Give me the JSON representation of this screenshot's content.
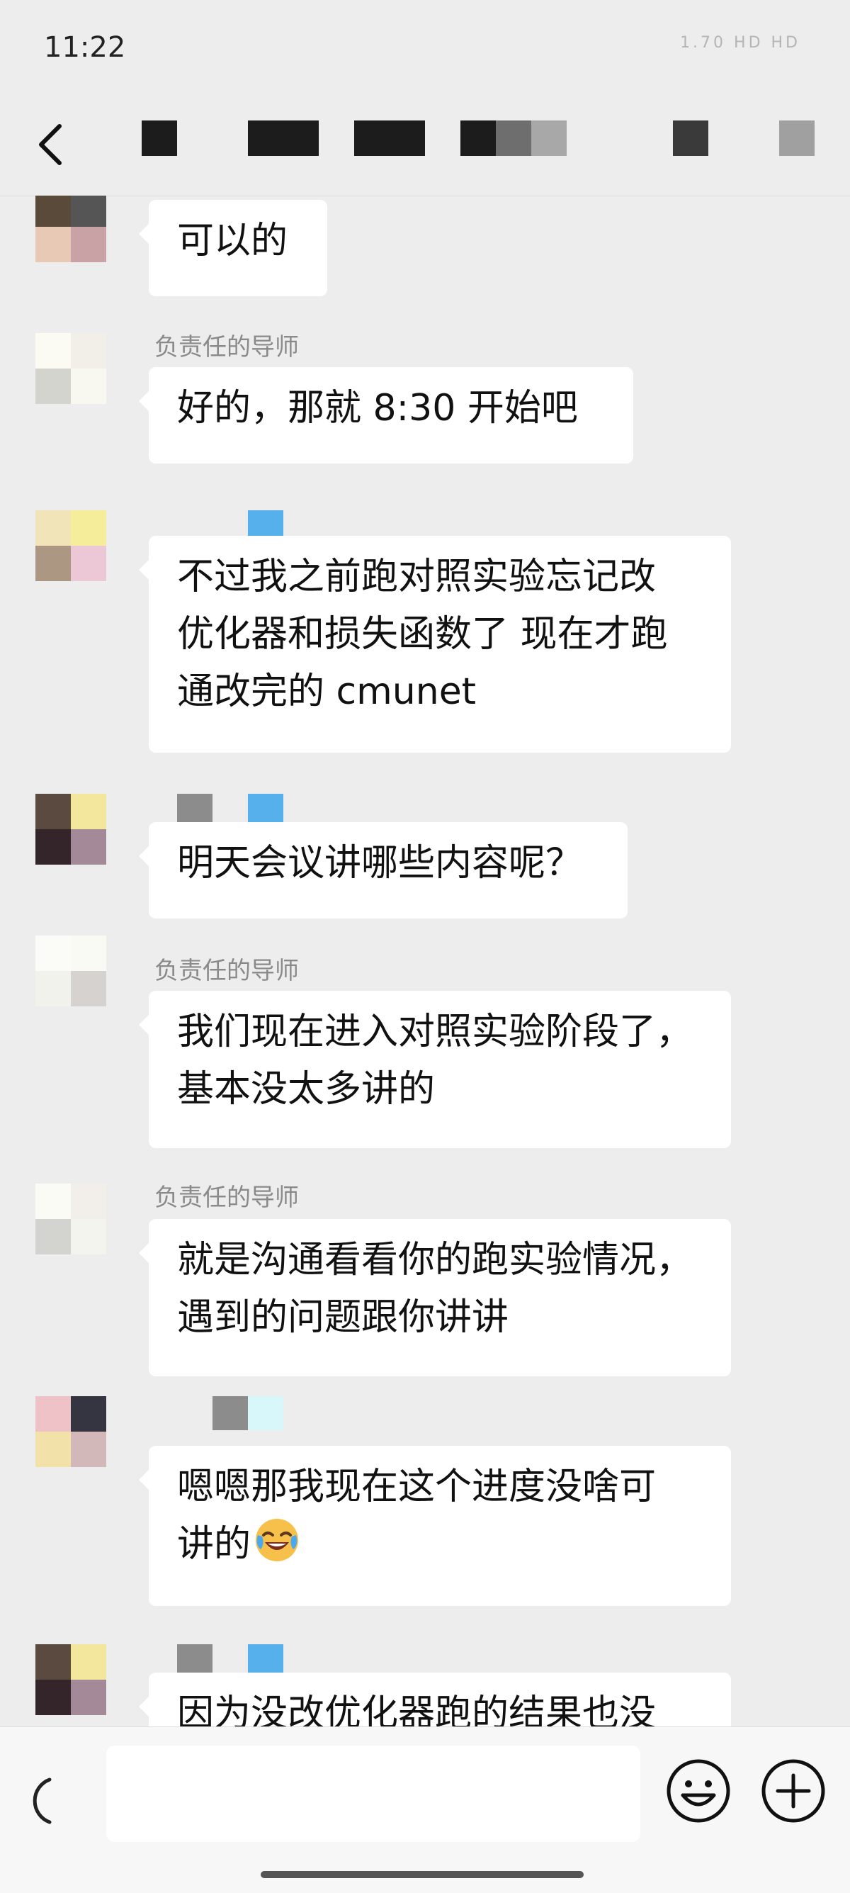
{
  "status_bar": {
    "time": "11:22",
    "indicators": "1.70 HD HD"
  },
  "header": {
    "back_icon": "chevron-left-icon"
  },
  "messages": [
    {
      "sender": "",
      "lines": [
        "可以的"
      ]
    },
    {
      "sender": "负责任的导师",
      "lines": [
        "好的，那就 8:30 开始吧"
      ]
    },
    {
      "sender": "",
      "lines": [
        "不过我之前跑对照实验忘记改",
        "优化器和损失函数了 现在才跑",
        "通改完的 cmunet"
      ]
    },
    {
      "sender": "",
      "lines": [
        "明天会议讲哪些内容呢？"
      ]
    },
    {
      "sender": "负责任的导师",
      "lines": [
        "我们现在进入对照实验阶段了，",
        "基本没太多讲的"
      ]
    },
    {
      "sender": "负责任的导师",
      "lines": [
        "就是沟通看看你的跑实验情况，",
        "遇到的问题跟你讲讲"
      ]
    },
    {
      "sender": "",
      "lines": [
        "嗯嗯那我现在这个进度没啥可",
        "讲的"
      ],
      "emoji": "face-with-tears-of-joy"
    },
    {
      "sender": "",
      "lines": [
        "因为没改优化器跑的结果也没"
      ]
    }
  ],
  "input_bar": {
    "placeholder": "",
    "voice_icon": "voice-icon",
    "emoji_icon": "emoji-icon",
    "plus_icon": "plus-icon"
  },
  "colors": {
    "background": "#ededed",
    "bubble": "#ffffff",
    "sender_name": "#8a8a8a",
    "input_bar": "#f7f7f7"
  }
}
